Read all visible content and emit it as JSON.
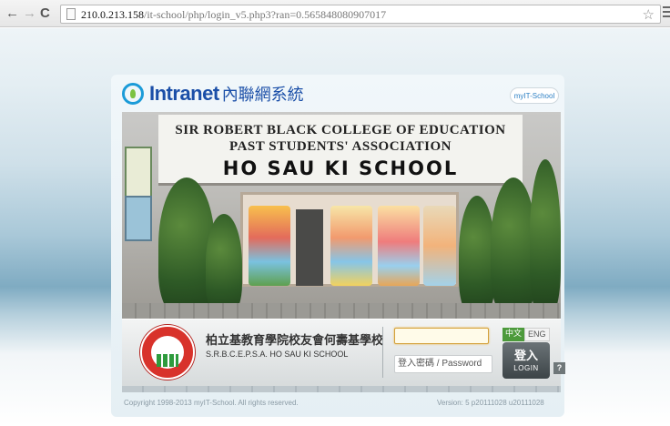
{
  "browser": {
    "url_host": "210.0.213.158",
    "url_path": "/it-school/php/login_v5.php3?ran=0.565848080907017",
    "back_icon": "arrow-left-icon",
    "forward_icon": "arrow-right-icon",
    "reload_icon": "reload-icon",
    "bookmark_icon": "star-icon",
    "menu_icon": "hamburger-menu-icon"
  },
  "header": {
    "brand": "Intranet",
    "brand_sub": "內聯網系統",
    "partner": "myIT-School"
  },
  "photo": {
    "sign_line1": "SIR ROBERT BLACK COLLEGE OF EDUCATION",
    "sign_line2": "PAST STUDENTS' ASSOCIATION",
    "sign_line3": "HO SAU KI SCHOOL"
  },
  "school": {
    "name_cn": "柏立基教育學院校友會何壽基學校",
    "name_en": "S.R.B.C.E.P.S.A. HO SAU KI SCHOOL"
  },
  "login": {
    "username_value": "",
    "password_placeholder": "登入密碼 / Password",
    "lang_zh": "中文",
    "lang_en": "ENG",
    "button_cn": "登入",
    "button_en": "LOGIN",
    "help": "?"
  },
  "footer": {
    "copyright": "Copyright 1998-2013 myIT-School. All rights reserved.",
    "version": "Version: 5 p20111028 u20111028"
  },
  "colors": {
    "brand_blue": "#1b4fa8",
    "login_button": "#3c4447",
    "lang_active": "#4c9a3b"
  }
}
